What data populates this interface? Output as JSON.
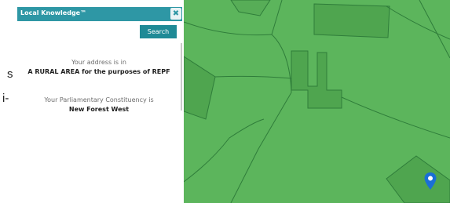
{
  "background_text": {
    "fragment_1": "s",
    "fragment_2": "i-"
  },
  "widget": {
    "title": "Local Knowledge™",
    "close_icon": "close-icon",
    "search_label": "Search",
    "address_intro": "Your address is in",
    "address_result": "A RURAL AREA for the purposes of REPF",
    "constituency_intro": "Your Parliamentary Constituency is",
    "constituency_result": "New Forest West"
  },
  "map": {
    "fill_color": "#5cb55c",
    "parcel_color": "#4fa54f",
    "boundary_color": "#2f7d3a",
    "marker_icon": "location-pin-icon",
    "marker_color": "#1a6fd6"
  },
  "colors": {
    "header": "#2e97a5",
    "button": "#1f8a96"
  }
}
